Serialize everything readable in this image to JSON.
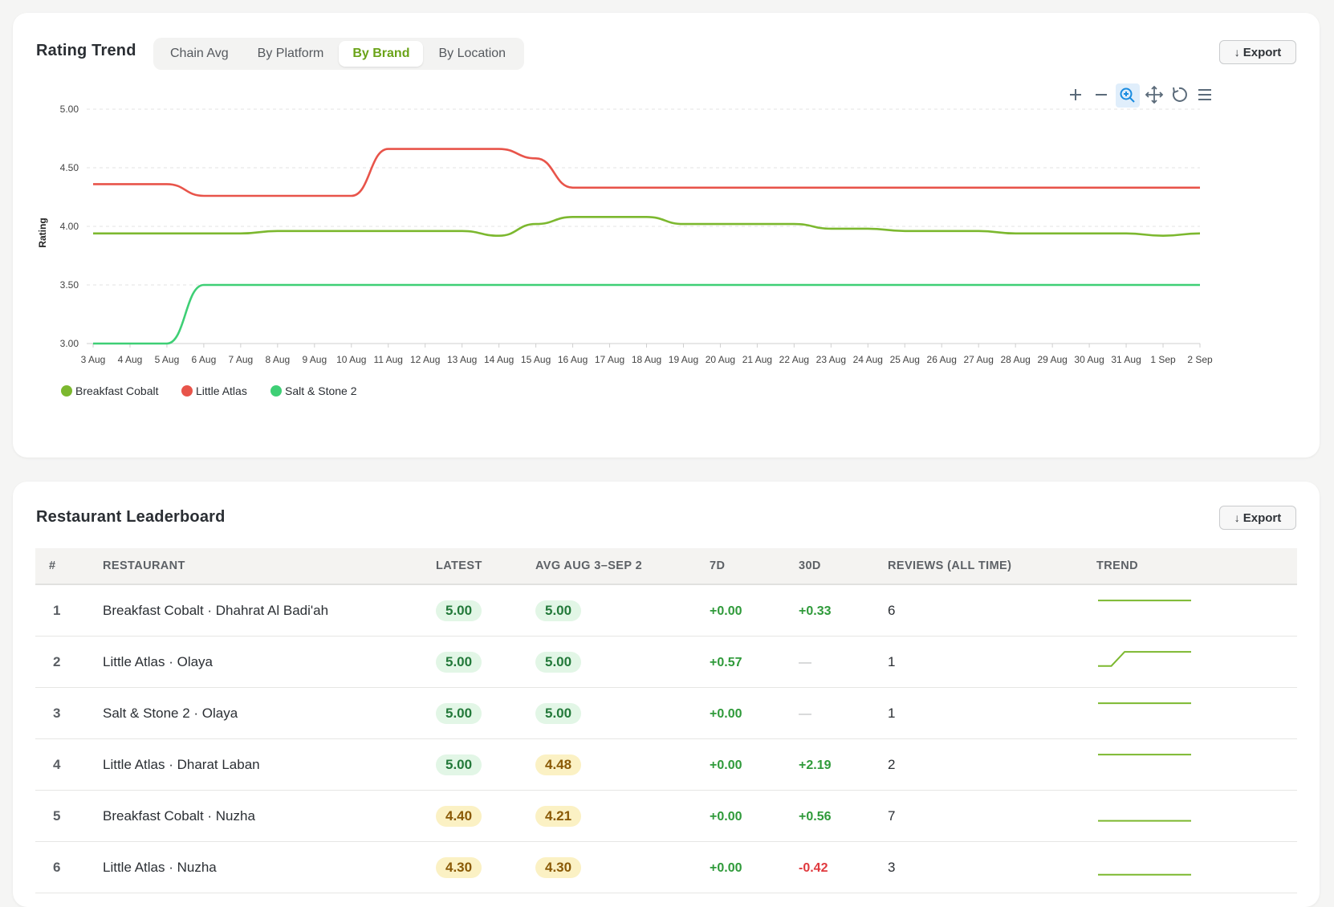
{
  "trend": {
    "title": "Rating Trend",
    "tabs": [
      "Chain Avg",
      "By Platform",
      "By Brand",
      "By Location"
    ],
    "active_tab": "By Brand",
    "export_label": "Export",
    "toolbar_icons": [
      "zoom-in-icon",
      "zoom-out-icon",
      "selection-zoom-icon",
      "pan-icon",
      "reset-icon",
      "menu-icon"
    ]
  },
  "chart_data": {
    "type": "line",
    "ylabel": "Rating",
    "xlabel": "",
    "ylim": [
      3.0,
      5.0
    ],
    "yticks": [
      "5.00",
      "4.50",
      "4.00",
      "3.50",
      "3.00"
    ],
    "grid": true,
    "legend_position": "bottom-left",
    "x": [
      "3 Aug",
      "4 Aug",
      "5 Aug",
      "6 Aug",
      "7 Aug",
      "8 Aug",
      "9 Aug",
      "10 Aug",
      "11 Aug",
      "12 Aug",
      "13 Aug",
      "14 Aug",
      "15 Aug",
      "16 Aug",
      "17 Aug",
      "18 Aug",
      "19 Aug",
      "20 Aug",
      "21 Aug",
      "22 Aug",
      "23 Aug",
      "24 Aug",
      "25 Aug",
      "26 Aug",
      "27 Aug",
      "28 Aug",
      "29 Aug",
      "30 Aug",
      "31 Aug",
      "1 Sep",
      "2 Sep"
    ],
    "series": [
      {
        "name": "Breakfast Cobalt",
        "color": "#7cb82f",
        "values": [
          3.94,
          3.94,
          3.94,
          3.94,
          3.94,
          3.96,
          3.96,
          3.96,
          3.96,
          3.96,
          3.96,
          3.92,
          4.02,
          4.08,
          4.08,
          4.08,
          4.02,
          4.02,
          4.02,
          4.02,
          3.98,
          3.98,
          3.96,
          3.96,
          3.96,
          3.94,
          3.94,
          3.94,
          3.94,
          3.92,
          3.94
        ]
      },
      {
        "name": "Little Atlas",
        "color": "#e8544a",
        "values": [
          4.36,
          4.36,
          4.36,
          4.26,
          4.26,
          4.26,
          4.26,
          4.26,
          4.66,
          4.66,
          4.66,
          4.66,
          4.58,
          4.33,
          4.33,
          4.33,
          4.33,
          4.33,
          4.33,
          4.33,
          4.33,
          4.33,
          4.33,
          4.33,
          4.33,
          4.33,
          4.33,
          4.33,
          4.33,
          4.33,
          4.33
        ]
      },
      {
        "name": "Salt & Stone 2",
        "color": "#3ecf75",
        "values": [
          3.0,
          3.0,
          3.0,
          3.5,
          3.5,
          3.5,
          3.5,
          3.5,
          3.5,
          3.5,
          3.5,
          3.5,
          3.5,
          3.5,
          3.5,
          3.5,
          3.5,
          3.5,
          3.5,
          3.5,
          3.5,
          3.5,
          3.5,
          3.5,
          3.5,
          3.5,
          3.5,
          3.5,
          3.5,
          3.5,
          3.5
        ]
      }
    ]
  },
  "leaderboard": {
    "title": "Restaurant Leaderboard",
    "export_label": "Export",
    "columns": [
      "#",
      "RESTAURANT",
      "LATEST",
      "AVG AUG 3–SEP 2",
      "7D",
      "30D",
      "REVIEWS (ALL TIME)",
      "TREND"
    ],
    "trend_color": "#7cb82f",
    "rows": [
      {
        "rank": "1",
        "name": "Breakfast Cobalt · Dhahrat Al Badi'ah",
        "latest": "5.00",
        "latest_tone": "green",
        "avg": "5.00",
        "avg_tone": "green",
        "d7": "+0.00",
        "d7_tone": "pos",
        "d30": "+0.33",
        "d30_tone": "pos",
        "reviews": "6",
        "trend": [
          5,
          5,
          5,
          5,
          5,
          5,
          5,
          5
        ]
      },
      {
        "rank": "2",
        "name": "Little Atlas · Olaya",
        "latest": "5.00",
        "latest_tone": "green",
        "avg": "5.00",
        "avg_tone": "green",
        "d7": "+0.57",
        "d7_tone": "pos",
        "d30": "—",
        "d30_tone": "none",
        "reviews": "1",
        "trend": [
          4.43,
          4.43,
          5,
          5,
          5,
          5,
          5,
          5
        ]
      },
      {
        "rank": "3",
        "name": "Salt & Stone 2 · Olaya",
        "latest": "5.00",
        "latest_tone": "green",
        "avg": "5.00",
        "avg_tone": "green",
        "d7": "+0.00",
        "d7_tone": "pos",
        "d30": "—",
        "d30_tone": "none",
        "reviews": "1",
        "trend": [
          5,
          5,
          5,
          5,
          5,
          5,
          5,
          5
        ]
      },
      {
        "rank": "4",
        "name": "Little Atlas · Dharat Laban",
        "latest": "5.00",
        "latest_tone": "green",
        "avg": "4.48",
        "avg_tone": "amber",
        "d7": "+0.00",
        "d7_tone": "pos",
        "d30": "+2.19",
        "d30_tone": "pos",
        "reviews": "2",
        "trend": [
          5,
          5,
          5,
          5,
          5,
          5,
          5,
          5
        ]
      },
      {
        "rank": "5",
        "name": "Breakfast Cobalt · Nuzha",
        "latest": "4.40",
        "latest_tone": "amber",
        "avg": "4.21",
        "avg_tone": "amber",
        "d7": "+0.00",
        "d7_tone": "pos",
        "d30": "+0.56",
        "d30_tone": "pos",
        "reviews": "7",
        "trend": [
          4.4,
          4.4,
          4.4,
          4.4,
          4.4,
          4.4,
          4.4,
          4.4
        ]
      },
      {
        "rank": "6",
        "name": "Little Atlas · Nuzha",
        "latest": "4.30",
        "latest_tone": "amber",
        "avg": "4.30",
        "avg_tone": "amber",
        "d7": "+0.00",
        "d7_tone": "pos",
        "d30": "-0.42",
        "d30_tone": "neg",
        "reviews": "3",
        "trend": [
          4.3,
          4.3,
          4.3,
          4.3,
          4.3,
          4.3,
          4.3,
          4.3
        ]
      }
    ]
  }
}
